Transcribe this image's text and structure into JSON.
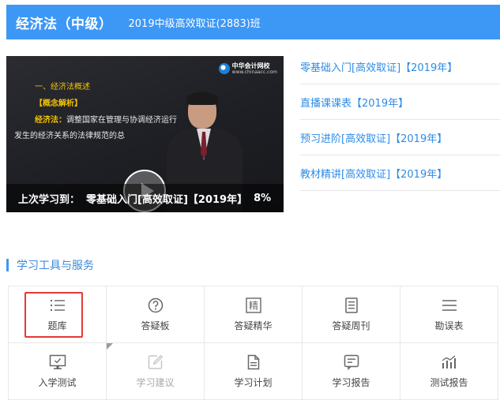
{
  "header": {
    "course": "经济法（中级）",
    "class_name": "2019中级高效取证(2883)班",
    "bg_color": "#3d97f5"
  },
  "video": {
    "logo_name": "中华会计网校",
    "logo_url": "www.chinaacc.com",
    "slide_line1": "一、经济法概述",
    "slide_line2": "【概念解析】",
    "slide_line3_term": "经济法：",
    "slide_line3_text": "调整国家在管理与协调经济运行",
    "slide_line4": "发生的经济关系的法律规范的总",
    "progress_prefix": "上次学习到：",
    "progress_course": "零基础入门[高效取证]【2019年】",
    "progress_percent": "8%"
  },
  "course_links": [
    "零基础入门[高效取证]【2019年】",
    "直播课课表【2019年】",
    "预习进阶[高效取证]【2019年】",
    "教材精讲[高效取证]【2019年】"
  ],
  "tools_section": {
    "title": "学习工具与服务",
    "accent_color": "#3d97f5",
    "highlight_color": "#e53935",
    "items": [
      {
        "label": "题库",
        "icon": "list-icon",
        "enabled": true,
        "highlighted": true
      },
      {
        "label": "答疑板",
        "icon": "question-circle-icon",
        "enabled": true
      },
      {
        "label": "答疑精华",
        "icon": "essence-char-icon",
        "icon_char": "精",
        "enabled": true
      },
      {
        "label": "答疑周刊",
        "icon": "document-icon",
        "enabled": true
      },
      {
        "label": "勘误表",
        "icon": "menu-lines-icon",
        "enabled": true
      },
      {
        "label": "入学测试",
        "icon": "monitor-icon",
        "enabled": true
      },
      {
        "label": "学习建议",
        "icon": "edit-icon",
        "enabled": false
      },
      {
        "label": "学习计划",
        "icon": "file-icon",
        "enabled": true
      },
      {
        "label": "学习报告",
        "icon": "report-icon",
        "enabled": true
      },
      {
        "label": "测试报告",
        "icon": "bar-chart-icon",
        "enabled": true
      }
    ]
  }
}
